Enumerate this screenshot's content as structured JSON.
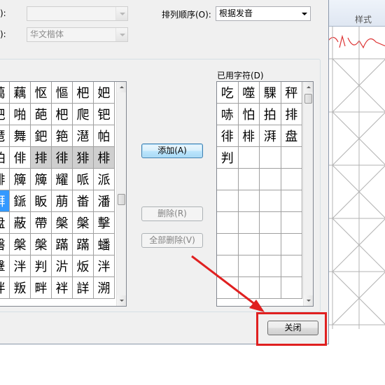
{
  "dialog": {
    "row1_label_suffix": "):",
    "row2_label_suffix": "):",
    "row1_combo_value": "",
    "font_combo_value": "华文楷体",
    "sort_label": "排列顺序(O):",
    "sort_combo_value": "根据发音",
    "used_chars_label": "已用字符(D)",
    "add_button": "添加(A)",
    "delete_button": "删除(R)",
    "delete_all_button": "全部删除(V)",
    "close_button": "关闭"
  },
  "available_chars": [
    [
      "蔼",
      "藕",
      "怄",
      "慪",
      "杷",
      "妑"
    ],
    [
      "耙",
      "啪",
      "葩",
      "杷",
      "爬",
      "钯"
    ],
    [
      "琶",
      "舞",
      "鈀",
      "筢",
      "潖",
      "帕"
    ],
    [
      "怕",
      "俳",
      "排",
      "徘",
      "猅",
      "棑"
    ],
    [
      "排",
      "簰",
      "簰",
      "耀",
      "哌",
      "派"
    ],
    [
      "湃",
      "鎃",
      "眅",
      "萠",
      "畨",
      "潘"
    ],
    [
      "盘",
      "蔽",
      "帶",
      "槃",
      "槃",
      "擊"
    ],
    [
      "磐",
      "槃",
      "槃",
      "蹣",
      "蹣",
      "蟠"
    ],
    [
      "鞶",
      "泮",
      "判",
      "沜",
      "炍",
      "泮"
    ],
    [
      "拌",
      "叛",
      "畔",
      "袢",
      "詳",
      "溯"
    ]
  ],
  "available_selected_row": 3,
  "available_selected_cols": [
    2,
    3,
    4,
    5
  ],
  "available_highlighted": {
    "row": 5,
    "col": 0
  },
  "used_chars": [
    [
      "吃",
      "噬",
      "騍",
      "秤"
    ],
    [
      "哧",
      "怕",
      "拍",
      "排"
    ],
    [
      "徘",
      "棑",
      "湃",
      "盘"
    ],
    [
      "判",
      "",
      "",
      ""
    ],
    [
      "",
      "",
      "",
      ""
    ],
    [
      "",
      "",
      "",
      ""
    ],
    [
      "",
      "",
      "",
      ""
    ],
    [
      "",
      "",
      "",
      ""
    ],
    [
      "",
      "",
      "",
      ""
    ],
    [
      "",
      "",
      "",
      ""
    ]
  ],
  "background": {
    "style_label": "样式"
  },
  "colors": {
    "annotation_red": "#e02020",
    "selection_gray": "#cfcfcf",
    "highlight_blue": "#3399ff"
  }
}
